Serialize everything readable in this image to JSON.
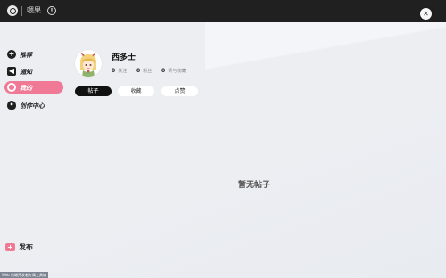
{
  "app": {
    "title": "喂果"
  },
  "sidebar": {
    "items": [
      {
        "label": "推荐",
        "icon": "plus-circle-icon"
      },
      {
        "label": "通知",
        "icon": "megaphone-icon"
      },
      {
        "label": "我的",
        "icon": "user-icon",
        "active": true
      },
      {
        "label": "创作中心",
        "icon": "lightbulb-icon"
      }
    ],
    "publish": {
      "label": "发布",
      "icon": "plus-square-icon"
    }
  },
  "profile": {
    "name": "西多士",
    "stats": [
      {
        "value": "0",
        "label": "关注"
      },
      {
        "value": "0",
        "label": "粉丝"
      },
      {
        "value": "0",
        "label": "赞与收藏"
      }
    ],
    "tabs": [
      {
        "label": "帖子",
        "active": true
      },
      {
        "label": "收藏"
      },
      {
        "label": "点赞"
      }
    ]
  },
  "empty_state": "暂无帖子",
  "footer_text": "Web 前端开发者专属工具箱",
  "colors": {
    "accent": "#f07a95",
    "topbar": "#202020"
  }
}
